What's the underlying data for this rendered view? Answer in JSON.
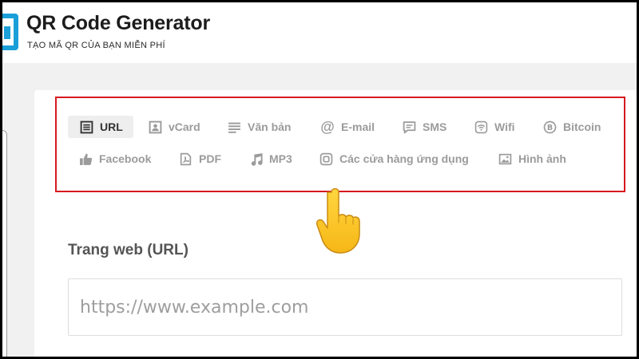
{
  "header": {
    "title": "QR Code Generator",
    "subtitle": "TẠO MÃ QR CỦA BẠN MIỄN PHÍ"
  },
  "tabs": [
    {
      "label": "URL",
      "icon": "document-lines-icon",
      "active": true
    },
    {
      "label": "vCard",
      "icon": "contact-card-icon"
    },
    {
      "label": "Văn bản",
      "icon": "text-lines-icon"
    },
    {
      "label": "E-mail",
      "icon": "at-sign-icon"
    },
    {
      "label": "SMS",
      "icon": "chat-bubble-icon"
    },
    {
      "label": "Wifi",
      "icon": "wifi-icon"
    },
    {
      "label": "Bitcoin",
      "icon": "bitcoin-icon"
    },
    {
      "label": "Facebook",
      "icon": "thumbs-up-icon"
    },
    {
      "label": "PDF",
      "icon": "pdf-file-icon"
    },
    {
      "label": "MP3",
      "icon": "music-note-icon"
    },
    {
      "label": "Các cửa hàng ứng dụng",
      "icon": "app-store-icon"
    },
    {
      "label": "Hình ảnh",
      "icon": "image-icon"
    }
  ],
  "form": {
    "label": "Trang web (URL)",
    "value": "",
    "placeholder": "https://www.example.com"
  },
  "colors": {
    "highlight_border": "#d71920",
    "tab_inactive": "#9b9b9b",
    "tab_active": "#333333",
    "brand": "#1a9fd8"
  }
}
